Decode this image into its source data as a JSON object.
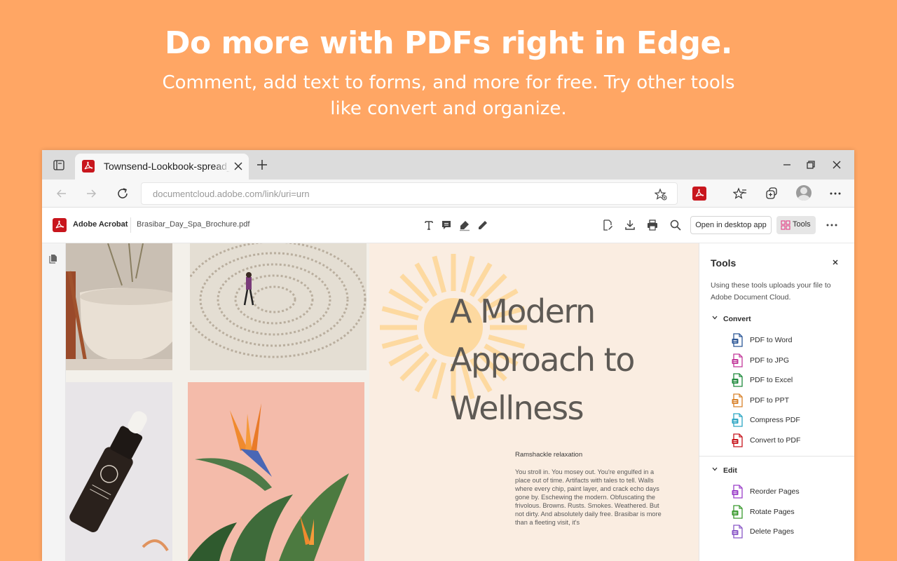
{
  "hero": {
    "headline": "Do more with PDFs right in Edge.",
    "subline": "Comment, add text to forms, and more for free. Try other tools like convert and organize."
  },
  "browser": {
    "tab_title": "Townsend-Lookbook-spread_red",
    "url": "documentcloud.adobe.com/link/uri=urn"
  },
  "acrobat": {
    "app_name": "Adobe Acrobat",
    "file_name": "Brasibar_Day_Spa_Brochure.pdf",
    "open_desktop_label": "Open in desktop app",
    "tools_label": "Tools"
  },
  "document": {
    "title_lines": [
      "A Modern",
      "Approach to",
      "Wellness"
    ],
    "subheading": "Ramshackle relaxation",
    "body": "You stroll in. You mosey out. You're engulfed in a place out of time. Artifacts with tales to tell. Walls where every chip, paint layer, and crack echo days gone by. Eschewing the modern. Obfuscating the frivolous. Browns. Rusts. Smokes. Weathered. But not dirty. And absolutely daily free. Brasibar is more than a fleeting visit, it's",
    "accent_color": "#FDD9A0"
  },
  "tools_panel": {
    "title": "Tools",
    "note": "Using these tools uploads your file to Adobe Document Cloud.",
    "convert": {
      "heading": "Convert",
      "items": [
        {
          "label": "PDF to Word",
          "icon": "word-icon",
          "color": "#2B5797"
        },
        {
          "label": "PDF to JPG",
          "icon": "jpg-icon",
          "color": "#C2389A"
        },
        {
          "label": "PDF to Excel",
          "icon": "excel-icon",
          "color": "#1E8A3C"
        },
        {
          "label": "PDF to PPT",
          "icon": "ppt-icon",
          "color": "#D9822B"
        },
        {
          "label": "Compress PDF",
          "icon": "compress-icon",
          "color": "#2BA6C4"
        },
        {
          "label": "Convert to PDF",
          "icon": "convert-icon",
          "color": "#C8161D"
        }
      ]
    },
    "edit": {
      "heading": "Edit",
      "items": [
        {
          "label": "Reorder Pages",
          "icon": "reorder-icon",
          "color": "#9B3FC9"
        },
        {
          "label": "Rotate Pages",
          "icon": "rotate-icon",
          "color": "#3A9A2E"
        },
        {
          "label": "Delete Pages",
          "icon": "delete-icon",
          "color": "#8A57C7"
        }
      ]
    }
  }
}
